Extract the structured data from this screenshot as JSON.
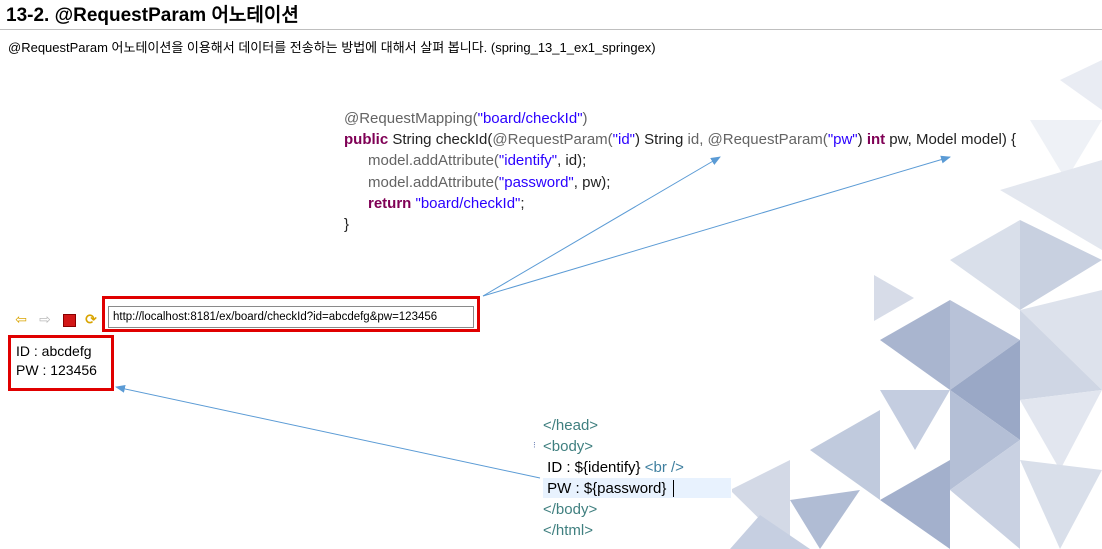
{
  "header": {
    "title": "13-2. @RequestParam 어노테이션",
    "subtitle": "@RequestParam 어노테이션을 이용해서 데이터를 전송하는 방법에 대해서 살펴 봅니다. (spring_13_1_ex1_springex)"
  },
  "code": {
    "l1_ann": "@RequestMapping(",
    "l1_str": "\"board/checkId\"",
    "l1_end": ")",
    "l2_kw": "public",
    "l2_a": " String checkId(",
    "l2_ann1": "@RequestParam(",
    "l2_str1": "\"id\"",
    "l2_b": ") String ",
    "l2_c": "id, ",
    "l2_ann2": "@RequestParam(",
    "l2_str2": "\"pw\"",
    "l2_d": ") ",
    "l2_kw2": "int",
    "l2_e": " pw, Model model) {",
    "l3_a": "model.addAttribute(",
    "l3_str": "\"identify\"",
    "l3_b": ", id);",
    "l4_a": "model.addAttribute(",
    "l4_str": "\"password\"",
    "l4_b": ", pw);",
    "l5_kw": "return",
    "l5_str": " \"board/checkId\"",
    "l5_b": ";",
    "l6": "}"
  },
  "browser": {
    "url": "http://localhost:8181/ex/board/checkId?id=abcdefg&pw=123456",
    "result_line1": "ID : abcdefg",
    "result_line2": "PW : 123456",
    "back_icon": "back-arrow-icon",
    "forward_icon": "forward-arrow-icon",
    "stop_icon": "stop-icon",
    "refresh_icon": "refresh-icon"
  },
  "jsp": {
    "line1": "</head>",
    "line2": "<body>",
    "line3_a": " ID : ${identify} ",
    "line3_b": "<br />",
    "line4": " PW : ${password}",
    "line5": "</body>",
    "line6": "</html>"
  },
  "colors": {
    "highlight_box": "#e00000",
    "arrow": "#5b9bd5",
    "keyword": "#7f0055",
    "string": "#2a00ff"
  }
}
